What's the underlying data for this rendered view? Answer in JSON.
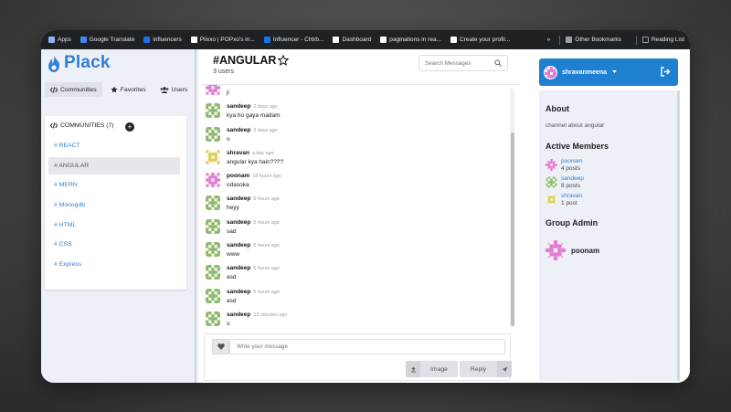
{
  "bookmarks": [
    {
      "label": "Apps",
      "color": "#8ab4f8"
    },
    {
      "label": "Google Translate",
      "color": "#4285f4"
    },
    {
      "label": "influencers",
      "color": "#1a73e8"
    },
    {
      "label": "Plixxo | POPxo's in...",
      "color": "#ffffff"
    },
    {
      "label": "Influencer - Chtrb...",
      "color": "#1a73e8"
    },
    {
      "label": "Dashboard",
      "color": "#ffffff"
    },
    {
      "label": "paginations in rea...",
      "color": "#ffffff"
    },
    {
      "label": "Create your profil...",
      "color": "#ffffff"
    }
  ],
  "bookmarks_more": "»",
  "bookmarks_other": "Other Bookmarks",
  "bookmarks_reading": "Reading List",
  "app": {
    "name": "Plack",
    "brand_color": "#2f80d6"
  },
  "left_tabs": [
    {
      "label": "Communities",
      "icon": "code-icon",
      "active": true
    },
    {
      "label": "Favorites",
      "icon": "star-icon",
      "active": false
    },
    {
      "label": "Users",
      "icon": "users-icon",
      "active": false
    }
  ],
  "communities": {
    "header": "COMMUNITIES (7)",
    "items": [
      {
        "label": "# REACT",
        "active": false
      },
      {
        "label": "# ANGULAR",
        "active": true
      },
      {
        "label": "# MERN",
        "active": false
      },
      {
        "label": "# Monogdb",
        "active": false
      },
      {
        "label": "# HTML",
        "active": false
      },
      {
        "label": "# CSS",
        "active": false
      },
      {
        "label": "# Express",
        "active": false
      }
    ]
  },
  "channel": {
    "title": "#ANGULAR",
    "users": "3 users"
  },
  "search": {
    "placeholder": "Search Messages"
  },
  "messages": [
    {
      "name": "",
      "time": "",
      "text": "ji",
      "avatar": "pink"
    },
    {
      "name": "sandeep",
      "time": "2 days ago",
      "text": "kya ho gaya madam",
      "avatar": "green"
    },
    {
      "name": "sandeep",
      "time": "2 days ago",
      "text": "o",
      "avatar": "green"
    },
    {
      "name": "shravan",
      "time": "a day ago",
      "text": "angular kya hain????",
      "avatar": "yellow"
    },
    {
      "name": "poonam",
      "time": "18 hours ago",
      "text": "odasoka",
      "avatar": "pink"
    },
    {
      "name": "sandeep",
      "time": "5 hours ago",
      "text": "heyy",
      "avatar": "green"
    },
    {
      "name": "sandeep",
      "time": "5 hours ago",
      "text": "sad",
      "avatar": "green"
    },
    {
      "name": "sandeep",
      "time": "5 hours ago",
      "text": "www",
      "avatar": "green"
    },
    {
      "name": "sandeep",
      "time": "5 hours ago",
      "text": "asd",
      "avatar": "green"
    },
    {
      "name": "sandeep",
      "time": "5 hours ago",
      "text": "asd",
      "avatar": "green"
    },
    {
      "name": "sandeep",
      "time": "13 minutes ago",
      "text": "o",
      "avatar": "green"
    }
  ],
  "compose": {
    "placeholder": "Write your message",
    "image_label": "Image",
    "reply_label": "Reply"
  },
  "current_user": {
    "name": "shravanmeena"
  },
  "about": {
    "heading": "About",
    "description": "channel about angular"
  },
  "active_members": {
    "heading": "Active Members",
    "members": [
      {
        "name": "poonam",
        "posts": "4 posts",
        "avatar": "pink"
      },
      {
        "name": "sandeep",
        "posts": "8 posts",
        "avatar": "green"
      },
      {
        "name": "shravan",
        "posts": "1 post",
        "avatar": "yellow"
      }
    ]
  },
  "group_admin": {
    "heading": "Group Admin",
    "name": "poonam"
  },
  "avatar_colors": {
    "pink": "#e27bd8",
    "green": "#86b96a",
    "yellow": "#d7cf4a"
  }
}
